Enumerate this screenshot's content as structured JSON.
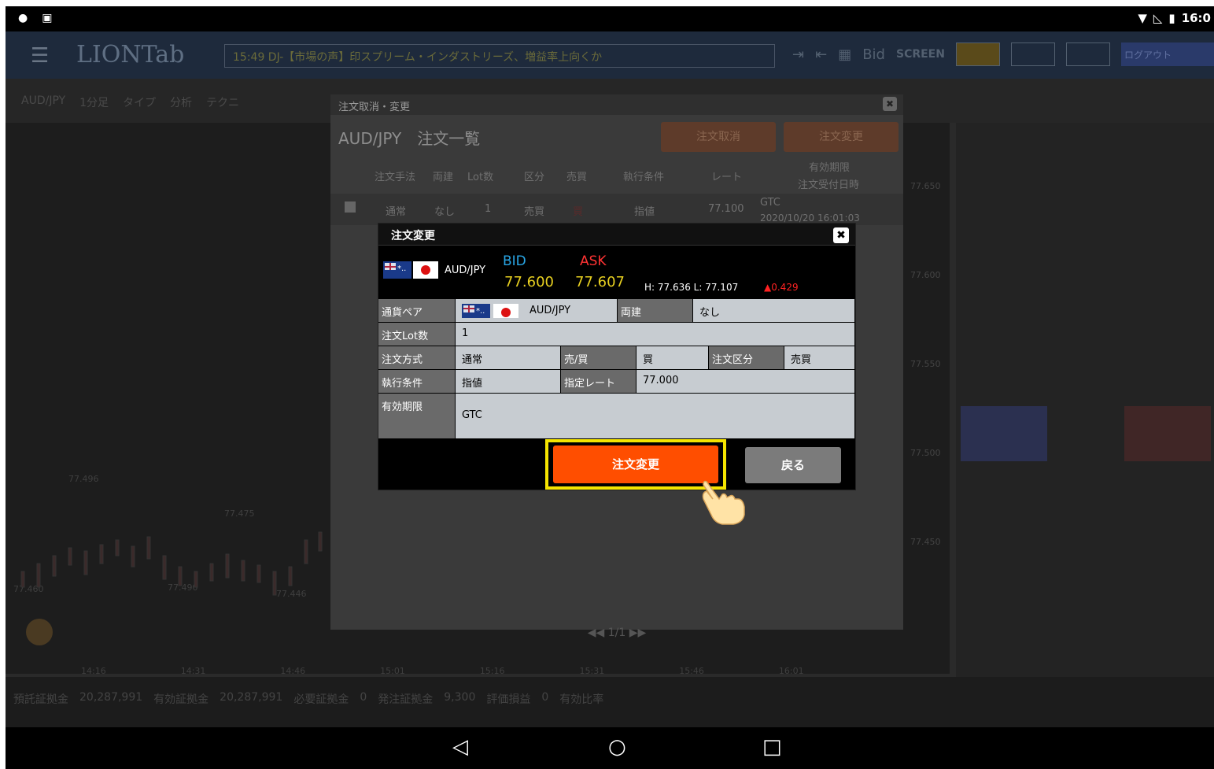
{
  "statusbar": {
    "time": "16:0"
  },
  "app": {
    "logo": "LIONTab",
    "news": "15:49 DJ-【市場の声】印スプリーム・インダストリーズ、増益率上向くか",
    "bid_toggle": "Bid",
    "screen_label": "SCREEN",
    "login_label": "ログアウト",
    "subbar": [
      "AUD/JPY",
      "1分足",
      "タイプ",
      "分析",
      "テクニ"
    ],
    "chart_prices": [
      "77.496",
      "77.475",
      "77.460",
      "77.490",
      "77.446"
    ],
    "chart_times": [
      "14:16",
      "14:31",
      "14:46",
      "15:01",
      "15:16",
      "15:31",
      "15:46",
      "16:01"
    ],
    "side_price_labels": [
      "77.650",
      "77.600",
      "77.550",
      "77.500",
      "77.450"
    ],
    "footer": [
      "預託証拠金",
      "20,287,991",
      "有効証拠金",
      "20,287,991",
      "必要証拠金",
      "0",
      "発注証拠金",
      "9,300",
      "評価損益",
      "0",
      "有効比率"
    ]
  },
  "outer_modal": {
    "header": "注文取消・変更",
    "title": "AUD/JPY　注文一覧",
    "cancel_button": "注文取消",
    "change_button": "注文変更",
    "columns": [
      "注文手法",
      "両建",
      "Lot数",
      "区分",
      "売買",
      "執行条件",
      "レート",
      "有効期限",
      "注文受付日時"
    ],
    "row": {
      "method": "通常",
      "both": "なし",
      "lots": "1",
      "category": "売買",
      "side": "買",
      "condition": "指値",
      "rate": "77.100",
      "expiry": "GTC",
      "received": "2020/10/20 16:01:03"
    },
    "pager": "1/1"
  },
  "dialog": {
    "title": "注文変更",
    "pair": "AUD/JPY",
    "bid_label": "BID",
    "ask_label": "ASK",
    "bid_value": "77.600",
    "ask_value": "77.607",
    "high_low": "H: 77.636  L: 77.107",
    "change": "▲0.429",
    "fields": {
      "pair_label": "通貨ペア",
      "pair_value": "AUD/JPY",
      "both_label": "両建",
      "both_value": "なし",
      "lot_label": "注文Lot数",
      "lot_value": "1",
      "method_label": "注文方式",
      "method_value": "通常",
      "side_label": "売/買",
      "side_value": "買",
      "category_label": "注文区分",
      "category_value": "売買",
      "condition_label": "執行条件",
      "condition_value": "指値",
      "rate_label": "指定レート",
      "rate_value": "77.000",
      "expiry_label": "有効期限",
      "expiry_value": "GTC"
    },
    "confirm_button": "注文変更",
    "back_button": "戻る"
  },
  "colors": {
    "confirm": "#ff4e00",
    "highlight": "#f5e400",
    "bid": "#29a6e6",
    "ask": "#ff3333",
    "price": "#e8d020"
  }
}
